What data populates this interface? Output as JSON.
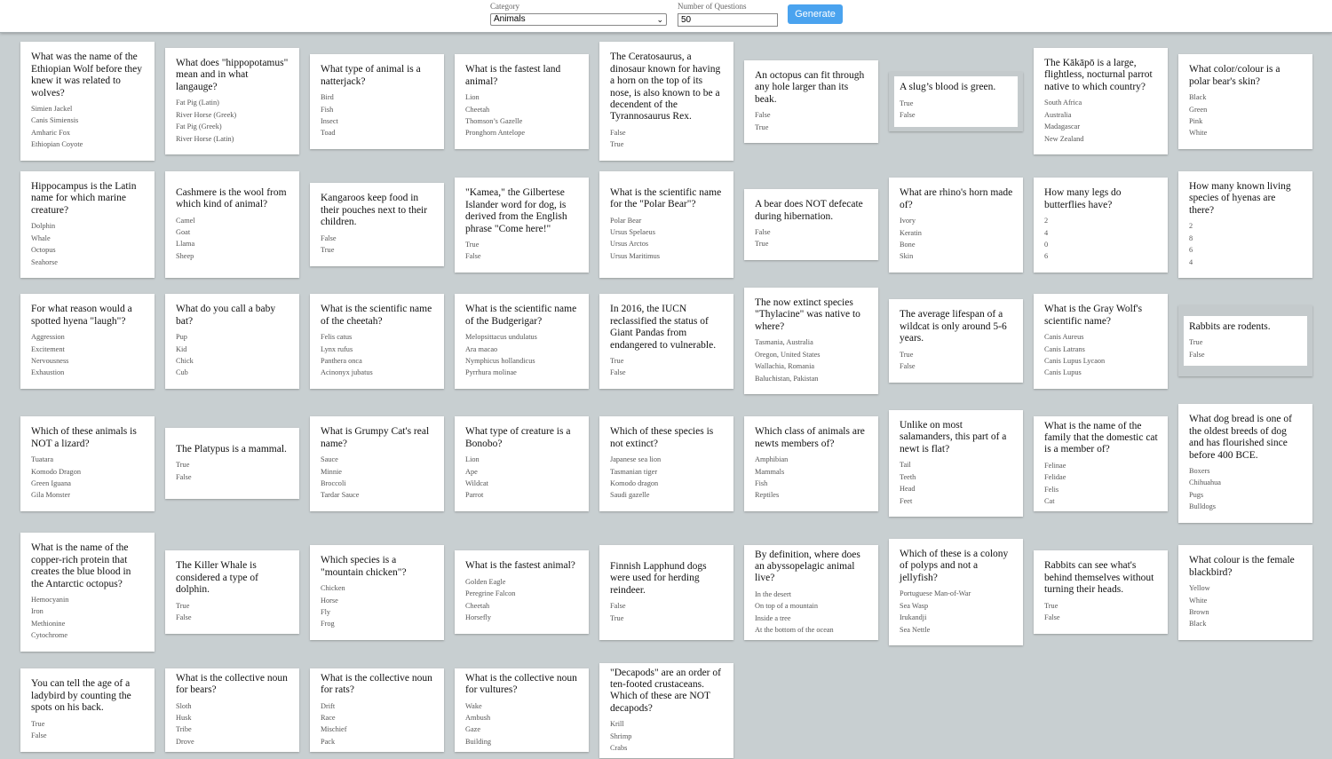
{
  "controls": {
    "category_label": "Category",
    "category_value": "Animals",
    "questions_label": "Number of Questions",
    "questions_value": "50",
    "generate_label": "Generate"
  },
  "cards": [
    {
      "q": "What was the name of the Ethiopian Wolf before they knew it was related to wolves?",
      "options": [
        "Simien Jackel",
        "Canis Simiensis",
        "Amharic Fox",
        "Ethiopian Coyote"
      ]
    },
    {
      "q": "What does \"hippopotamus\" mean and in what langauge?",
      "options": [
        "Fat Pig (Latin)",
        "River Horse (Greek)",
        "Fat Pig (Greek)",
        "River Horse (Latin)"
      ]
    },
    {
      "q": "What type of animal is a natterjack?",
      "options": [
        "Bird",
        "Fish",
        "Insect",
        "Toad"
      ]
    },
    {
      "q": "What is the fastest land animal?",
      "options": [
        "Lion",
        "Cheetah",
        "Thomson’s Gazelle",
        "Pronghorn Antelope"
      ]
    },
    {
      "q": "The Ceratosaurus, a dinosaur known for having a horn on the top of its nose, is also known to be a decendent of the Tyrannosaurus Rex.",
      "options": [
        "False",
        "True"
      ]
    },
    {
      "q": "An octopus can fit through any hole larger than its beak.",
      "options": [
        "False",
        "True"
      ]
    },
    {
      "q": "A slug’s blood is green.",
      "options": [
        "True",
        "False"
      ]
    },
    {
      "q": "The Kākāpō is a large, flightless, nocturnal parrot native to which country?",
      "options": [
        "South Africa",
        "Australia",
        "Madagascar",
        "New Zealand"
      ]
    },
    {
      "q": "What color/colour is a polar bear's skin?",
      "options": [
        "Black",
        "Green",
        "Pink",
        "White"
      ]
    },
    {
      "q": "Hippocampus is the Latin name for which marine creature?",
      "options": [
        "Dolphin",
        "Whale",
        "Octopus",
        "Seahorse"
      ]
    },
    {
      "q": "Cashmere is the wool from which kind of animal?",
      "options": [
        "Camel",
        "Goat",
        "Llama",
        "Sheep"
      ]
    },
    {
      "q": "Kangaroos keep food in their pouches next to their children.",
      "options": [
        "False",
        "True"
      ]
    },
    {
      "q": "\"Kamea,\" the Gilbertese Islander word for dog, is derived from the English phrase \"Come here!\"",
      "options": [
        "True",
        "False"
      ]
    },
    {
      "q": "What is the scientific name for the \"Polar Bear\"?",
      "options": [
        "Polar Bear",
        "Ursus Spelaeus",
        "Ursus Arctos",
        "Ursus Maritimus"
      ]
    },
    {
      "q": "A bear does NOT defecate during hibernation.",
      "options": [
        "False",
        "True"
      ]
    },
    {
      "q": "What are rhino's horn made of?",
      "options": [
        "Ivory",
        "Keratin",
        "Bone",
        "Skin"
      ]
    },
    {
      "q": "How many legs do butterflies have?",
      "options": [
        "2",
        "4",
        "0",
        "6"
      ]
    },
    {
      "q": "How many known living species of hyenas are there?",
      "options": [
        "2",
        "8",
        "6",
        "4"
      ]
    },
    {
      "q": "For what reason would a spotted hyena \"laugh\"?",
      "options": [
        "Aggression",
        "Excitement",
        "Nervousness",
        "Exhaustion"
      ]
    },
    {
      "q": "What do you call a baby bat?",
      "options": [
        "Pup",
        "Kid",
        "Chick",
        "Cub"
      ]
    },
    {
      "q": "What is the scientific name of the cheetah?",
      "options": [
        "Felis catus",
        "Lynx rufus",
        "Panthera onca",
        "Acinonyx jubatus"
      ]
    },
    {
      "q": "What is the scientific name of the Budgerigar?",
      "options": [
        "Melopsittacus undulatus",
        "Ara macao",
        "Nymphicus hollandicus",
        "Pyrrhura molinae"
      ]
    },
    {
      "q": "In 2016, the IUCN reclassified the status of Giant Pandas from endangered to vulnerable.",
      "options": [
        "True",
        "False"
      ]
    },
    {
      "q": "The now extinct species \"Thylacine\" was native to where?",
      "options": [
        "Tasmania, Australia",
        "Oregon, United States",
        "Wallachia, Romania",
        "Baluchistan, Pakistan"
      ]
    },
    {
      "q": "The average lifespan of a wildcat is only around 5-6 years.",
      "options": [
        "True",
        "False"
      ]
    },
    {
      "q": "What is the Gray Wolf's scientific name?",
      "options": [
        "Canis Aureus",
        "Canis Latrans",
        "Canis Lupus Lycaon",
        "Canis Lupus"
      ]
    },
    {
      "q": "Rabbits are rodents.",
      "options": [
        "True",
        "False"
      ]
    },
    {
      "q": "Which of these animals is NOT a lizard?",
      "options": [
        "Tuatara",
        "Komodo Dragon",
        "Green Iguana",
        "Gila Monster"
      ]
    },
    {
      "q": "The Platypus is a mammal.",
      "options": [
        "True",
        "False"
      ]
    },
    {
      "q": "What is Grumpy Cat's real name?",
      "options": [
        "Sauce",
        "Minnie",
        "Broccoli",
        "Tardar Sauce"
      ]
    },
    {
      "q": "What type of creature is a Bonobo?",
      "options": [
        "Lion",
        "Ape",
        "Wildcat",
        "Parrot"
      ]
    },
    {
      "q": "Which of these species is not extinct?",
      "options": [
        "Japanese sea lion",
        "Tasmanian tiger",
        "Komodo dragon",
        "Saudi gazelle"
      ]
    },
    {
      "q": "Which class of animals are newts members of?",
      "options": [
        "Amphibian",
        "Mammals",
        "Fish",
        "Reptiles"
      ]
    },
    {
      "q": "Unlike on most salamanders, this part of a newt is flat?",
      "options": [
        "Tail",
        "Teeth",
        "Head",
        "Feet"
      ]
    },
    {
      "q": "What is the name of the family that the domestic cat is a member of?",
      "options": [
        "Felinae",
        "Felidae",
        "Felis",
        "Cat"
      ]
    },
    {
      "q": "What dog bread is one of the oldest breeds of dog and has flourished since before 400 BCE.",
      "options": [
        "Boxers",
        "Chihuahua",
        "Pugs",
        "Bulldogs"
      ]
    },
    {
      "q": "What is the name of the copper-rich protein that creates the blue blood in the Antarctic octopus?",
      "options": [
        "Hemocyanin",
        "Iron",
        "Methionine",
        "Cytochrome"
      ]
    },
    {
      "q": "The Killer Whale is considered a type of dolphin.",
      "options": [
        "True",
        "False"
      ]
    },
    {
      "q": "Which species is a \"mountain chicken\"?",
      "options": [
        "Chicken",
        "Horse",
        "Fly",
        "Frog"
      ]
    },
    {
      "q": "What is the fastest animal?",
      "options": [
        "Golden Eagle",
        "Peregrine Falcon",
        "Cheetah",
        "Horsefly"
      ]
    },
    {
      "q": "Finnish Lapphund dogs were used for herding reindeer.",
      "options": [
        "False",
        "True"
      ]
    },
    {
      "q": "By definition, where does an abyssopelagic animal live?",
      "options": [
        "In the desert",
        "On top of a mountain",
        "Inside a tree",
        "At the bottom of the ocean"
      ]
    },
    {
      "q": "Which of these is a colony of polyps and not a jellyfish?",
      "options": [
        "Portuguese Man-of-War",
        "Sea Wasp",
        "Irukandji",
        "Sea Nettle"
      ]
    },
    {
      "q": "Rabbits can see what's behind themselves without turning their heads.",
      "options": [
        "True",
        "False"
      ]
    },
    {
      "q": "What colour is the female blackbird?",
      "options": [
        "Yellow",
        "White",
        "Brown",
        "Black"
      ]
    },
    {
      "q": "You can tell the age of a ladybird by counting the spots on his back.",
      "options": [
        "True",
        "False"
      ]
    },
    {
      "q": "What is the collective noun for bears?",
      "options": [
        "Sloth",
        "Husk",
        "Tribe",
        "Drove"
      ]
    },
    {
      "q": "What is the collective noun for rats?",
      "options": [
        "Drift",
        "Race",
        "Mischief",
        "Pack"
      ]
    },
    {
      "q": "What is the collective noun for vultures?",
      "options": [
        "Wake",
        "Ambush",
        "Gaze",
        "Building"
      ]
    },
    {
      "q": "\"Decapods\" are an order of ten-footed crustaceans. Which of these are NOT decapods?",
      "options": [
        "Krill",
        "Shrimp",
        "Crabs"
      ]
    }
  ]
}
